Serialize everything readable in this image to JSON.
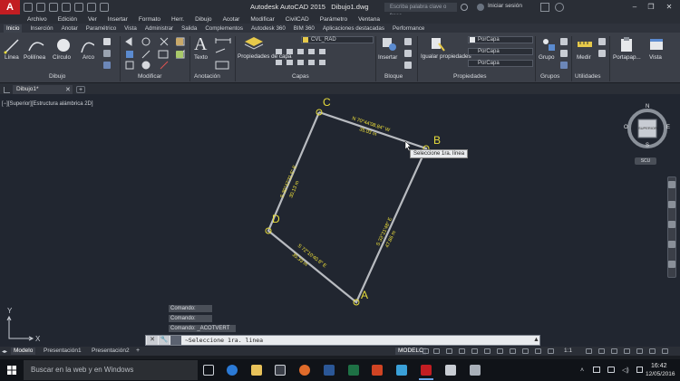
{
  "title_bar": {
    "app_title": "Autodesk AutoCAD 2015",
    "doc_title": "Dibujo1.dwg",
    "search_placeholder": "Escriba palabra clave o frase",
    "login_label": "Iniciar sesión"
  },
  "menu": [
    "Archivo",
    "Edición",
    "Ver",
    "Insertar",
    "Formato",
    "Herr.",
    "Dibujo",
    "Acotar",
    "Modificar",
    "CivilCAD",
    "Parámetro",
    "Ventana"
  ],
  "ribbon_tabs": [
    "Inicio",
    "Inserción",
    "Anotar",
    "Paramétrico",
    "Vista",
    "Administrar",
    "Salida",
    "Complementos",
    "Autodesk 360",
    "BIM 360",
    "Aplicaciones destacadas",
    "Performance"
  ],
  "ribbon": {
    "draw_buttons": [
      "Línea",
      "Polilínea",
      "Círculo",
      "Arco"
    ],
    "text_button": "Texto",
    "layer_props_button": "Propiedades de capa",
    "layer_name": "CVL_RAD",
    "insert_button": "Insertar",
    "match_props_button": "Igualar propiedades",
    "props_value_1": "PorCapa",
    "props_value_2": "PorCapa",
    "props_value_3": "PorCapa",
    "group_button": "Grupo",
    "measure_button": "Medir",
    "paste_button": "Portapap...",
    "view_button": "Vista",
    "panels": [
      "Dibujo",
      "Modificar",
      "Anotación",
      "Capas",
      "Bloque",
      "Propiedades",
      "Grupos",
      "Utilidades"
    ]
  },
  "doc_tab": "Dibujo1*",
  "viewport_label": "[−][Superior][Estructura alámbrica 2D]",
  "drawing": {
    "points": [
      "C",
      "B",
      "D",
      "A"
    ],
    "dim_cb": "N 70°44'08.84\" W",
    "dim_cb_len": "35.03 m",
    "dim_ba": "S 33°21'48\" E",
    "dim_ba_len": "47.86 m",
    "dim_cd": "S 30°47'31.5\" E",
    "dim_cd_len": "30.13 m",
    "dim_da": "S 72°10'40.8\" E",
    "dim_da_len": "35.33 m",
    "tooltip": "Seleccione 1ra. línea"
  },
  "viewcube": {
    "top": "SUPERIOR",
    "n": "N",
    "s": "S",
    "e": "E",
    "w": "O",
    "wcs": "SCU"
  },
  "ucs": {
    "x": "X",
    "y": "Y"
  },
  "command": {
    "history": [
      "Comando:",
      "Comando:",
      "Comando: _ACOTVERT"
    ],
    "prompt": "~Seleccione 1ra. linea"
  },
  "layout_tabs": [
    "Modelo",
    "Presentación1",
    "Presentación2"
  ],
  "status": {
    "mode": "MODELO",
    "scale": "1:1"
  },
  "taskbar": {
    "search": "Buscar en la web y en Windows",
    "time": "16:42",
    "date": "12/05/2016"
  },
  "colors": {
    "canvas": "#212630",
    "polyline": "#b8bbc0",
    "dimension": "#f2e33a",
    "point_label": "#e8dd3c",
    "accent": "#c21d22"
  }
}
